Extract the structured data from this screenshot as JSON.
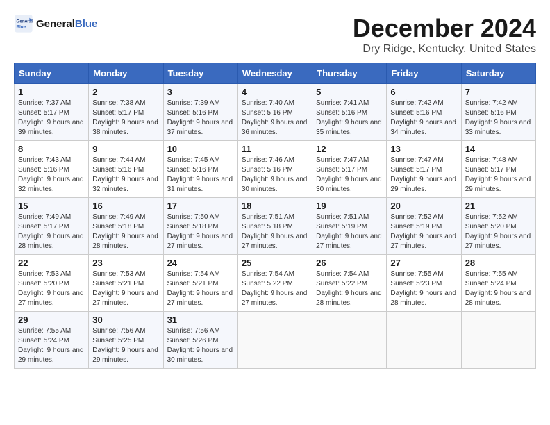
{
  "header": {
    "logo_text_general": "General",
    "logo_text_blue": "Blue",
    "main_title": "December 2024",
    "subtitle": "Dry Ridge, Kentucky, United States"
  },
  "calendar": {
    "weekdays": [
      "Sunday",
      "Monday",
      "Tuesday",
      "Wednesday",
      "Thursday",
      "Friday",
      "Saturday"
    ],
    "weeks": [
      [
        {
          "day": "1",
          "sunrise": "7:37 AM",
          "sunset": "5:17 PM",
          "daylight": "9 hours and 39 minutes."
        },
        {
          "day": "2",
          "sunrise": "7:38 AM",
          "sunset": "5:17 PM",
          "daylight": "9 hours and 38 minutes."
        },
        {
          "day": "3",
          "sunrise": "7:39 AM",
          "sunset": "5:16 PM",
          "daylight": "9 hours and 37 minutes."
        },
        {
          "day": "4",
          "sunrise": "7:40 AM",
          "sunset": "5:16 PM",
          "daylight": "9 hours and 36 minutes."
        },
        {
          "day": "5",
          "sunrise": "7:41 AM",
          "sunset": "5:16 PM",
          "daylight": "9 hours and 35 minutes."
        },
        {
          "day": "6",
          "sunrise": "7:42 AM",
          "sunset": "5:16 PM",
          "daylight": "9 hours and 34 minutes."
        },
        {
          "day": "7",
          "sunrise": "7:42 AM",
          "sunset": "5:16 PM",
          "daylight": "9 hours and 33 minutes."
        }
      ],
      [
        {
          "day": "8",
          "sunrise": "7:43 AM",
          "sunset": "5:16 PM",
          "daylight": "9 hours and 32 minutes."
        },
        {
          "day": "9",
          "sunrise": "7:44 AM",
          "sunset": "5:16 PM",
          "daylight": "9 hours and 32 minutes."
        },
        {
          "day": "10",
          "sunrise": "7:45 AM",
          "sunset": "5:16 PM",
          "daylight": "9 hours and 31 minutes."
        },
        {
          "day": "11",
          "sunrise": "7:46 AM",
          "sunset": "5:16 PM",
          "daylight": "9 hours and 30 minutes."
        },
        {
          "day": "12",
          "sunrise": "7:47 AM",
          "sunset": "5:17 PM",
          "daylight": "9 hours and 30 minutes."
        },
        {
          "day": "13",
          "sunrise": "7:47 AM",
          "sunset": "5:17 PM",
          "daylight": "9 hours and 29 minutes."
        },
        {
          "day": "14",
          "sunrise": "7:48 AM",
          "sunset": "5:17 PM",
          "daylight": "9 hours and 29 minutes."
        }
      ],
      [
        {
          "day": "15",
          "sunrise": "7:49 AM",
          "sunset": "5:17 PM",
          "daylight": "9 hours and 28 minutes."
        },
        {
          "day": "16",
          "sunrise": "7:49 AM",
          "sunset": "5:18 PM",
          "daylight": "9 hours and 28 minutes."
        },
        {
          "day": "17",
          "sunrise": "7:50 AM",
          "sunset": "5:18 PM",
          "daylight": "9 hours and 27 minutes."
        },
        {
          "day": "18",
          "sunrise": "7:51 AM",
          "sunset": "5:18 PM",
          "daylight": "9 hours and 27 minutes."
        },
        {
          "day": "19",
          "sunrise": "7:51 AM",
          "sunset": "5:19 PM",
          "daylight": "9 hours and 27 minutes."
        },
        {
          "day": "20",
          "sunrise": "7:52 AM",
          "sunset": "5:19 PM",
          "daylight": "9 hours and 27 minutes."
        },
        {
          "day": "21",
          "sunrise": "7:52 AM",
          "sunset": "5:20 PM",
          "daylight": "9 hours and 27 minutes."
        }
      ],
      [
        {
          "day": "22",
          "sunrise": "7:53 AM",
          "sunset": "5:20 PM",
          "daylight": "9 hours and 27 minutes."
        },
        {
          "day": "23",
          "sunrise": "7:53 AM",
          "sunset": "5:21 PM",
          "daylight": "9 hours and 27 minutes."
        },
        {
          "day": "24",
          "sunrise": "7:54 AM",
          "sunset": "5:21 PM",
          "daylight": "9 hours and 27 minutes."
        },
        {
          "day": "25",
          "sunrise": "7:54 AM",
          "sunset": "5:22 PM",
          "daylight": "9 hours and 27 minutes."
        },
        {
          "day": "26",
          "sunrise": "7:54 AM",
          "sunset": "5:22 PM",
          "daylight": "9 hours and 28 minutes."
        },
        {
          "day": "27",
          "sunrise": "7:55 AM",
          "sunset": "5:23 PM",
          "daylight": "9 hours and 28 minutes."
        },
        {
          "day": "28",
          "sunrise": "7:55 AM",
          "sunset": "5:24 PM",
          "daylight": "9 hours and 28 minutes."
        }
      ],
      [
        {
          "day": "29",
          "sunrise": "7:55 AM",
          "sunset": "5:24 PM",
          "daylight": "9 hours and 29 minutes."
        },
        {
          "day": "30",
          "sunrise": "7:56 AM",
          "sunset": "5:25 PM",
          "daylight": "9 hours and 29 minutes."
        },
        {
          "day": "31",
          "sunrise": "7:56 AM",
          "sunset": "5:26 PM",
          "daylight": "9 hours and 30 minutes."
        },
        null,
        null,
        null,
        null
      ]
    ]
  }
}
